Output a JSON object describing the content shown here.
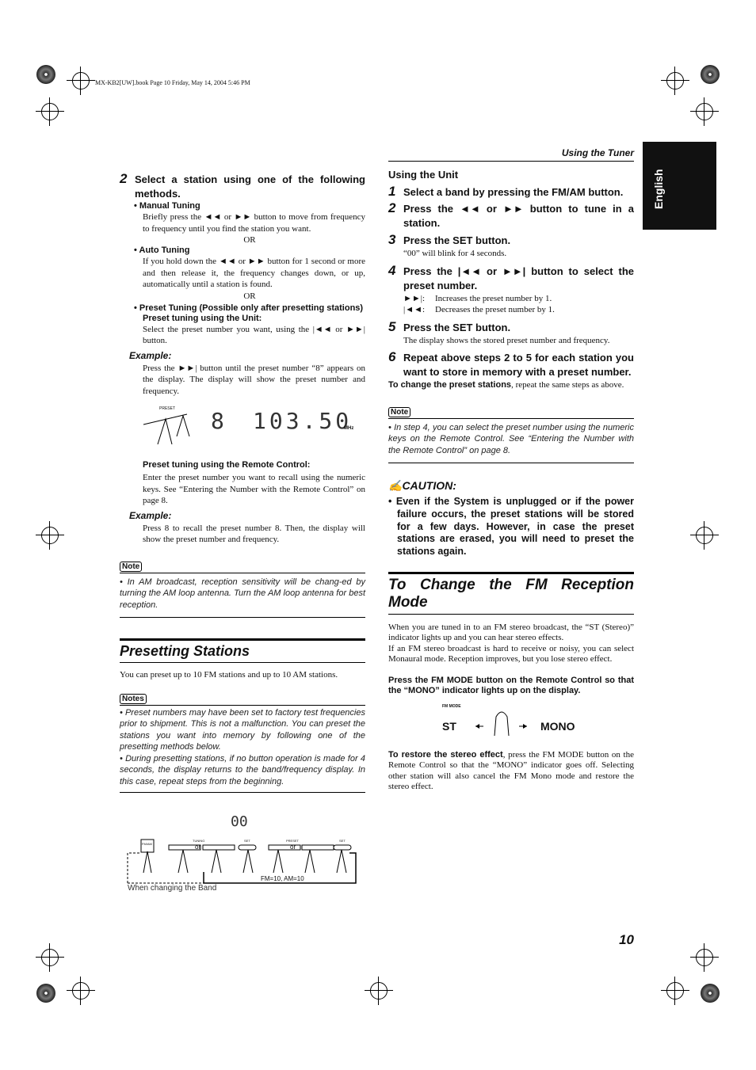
{
  "header": {
    "file_info": "MX-KB2[UW].book  Page 10  Friday, May 14, 2004  5:46 PM",
    "section": "Using the Tuner",
    "language_tab": "English",
    "page_number": "10"
  },
  "left": {
    "step2": {
      "num": "2",
      "title": "Select a station using one of the following methods.",
      "manual_title": "• Manual Tuning",
      "manual_text": "Briefly press the ◄◄ or ►► button to move from frequency to frequency until you find the station you want.",
      "or1": "OR",
      "auto_title": "• Auto Tuning",
      "auto_text": "If you hold down the ◄◄ or ►► button for 1 second or more and then release it, the frequency changes down, or up, automatically until a station is found.",
      "or2": "OR",
      "preset_title": "• Preset Tuning (Possible only after presetting stations)",
      "preset_unit_title": "Preset tuning using the Unit:",
      "preset_unit_text": "Select the preset number you want, using the |◄◄ or ►►| button.",
      "example1_label": "Example:",
      "example1_text": "Press the ►►| button until the preset number “8” appears on the display. The display will show the preset number and frequency.",
      "display": {
        "preset": "8",
        "freq": "103.50",
        "unit": "MHz",
        "button_label": "PRESET"
      },
      "remote_title": "Preset tuning using the Remote Control:",
      "remote_text": "Enter the preset number you want to recall using the numeric keys. See “Entering the Number with the Remote Control” on page 8.",
      "example2_label": "Example:",
      "example2_text": "Press 8 to recall the preset number 8. Then, the display will show the preset number and frequency."
    },
    "note1": {
      "tag": "Note",
      "text": "• In AM broadcast, reception sensitivity will be chang-ed by turning the AM loop antenna. Turn the AM loop antenna for best reception."
    },
    "presetting": {
      "title": "Presetting Stations",
      "intro": "You can preset up to 10 FM stations and up to 10 AM stations.",
      "notes_tag": "Notes",
      "notes": [
        "• Preset numbers may have been set to factory test frequencies prior to shipment. This is not a malfunction. You can preset the stations you want into memory by following one of the presetting methods below.",
        "• During presetting stations, if no button operation is made for 4 seconds, the display returns to the band/frequency display. In this case, repeat steps from the beginning."
      ]
    },
    "diagram": {
      "blink": "00",
      "fmam": "FM/AM",
      "tuning": "TUNING",
      "preset": "PRESET",
      "set": "SET",
      "or": "or",
      "count": "FM=10, AM=10",
      "band_note": "When changing the Band"
    }
  },
  "right": {
    "unit_title": "Using the Unit",
    "steps": [
      {
        "num": "1",
        "title": "Select a band by pressing the FM/AM button."
      },
      {
        "num": "2",
        "title": "Press the ◄◄ or ►► button to tune in a station."
      },
      {
        "num": "3",
        "title": "Press the SET button.",
        "text": "“00” will blink for 4 seconds."
      },
      {
        "num": "4",
        "title": "Press the |◄◄ or ►►| button to select the preset number.",
        "items": [
          {
            "key": "►►|:",
            "val": "Increases the preset number by 1."
          },
          {
            "key": "|◄◄:",
            "val": "Decreases the preset number by 1."
          }
        ]
      },
      {
        "num": "5",
        "title": "Press the SET button.",
        "text": "The display shows the stored preset number and frequency."
      },
      {
        "num": "6",
        "title": "Repeat above steps 2 to 5 for each station you want to store in memory with a preset number."
      }
    ],
    "change_bold": "To change the preset stations",
    "change_rest": ", repeat the same steps as above.",
    "note": {
      "tag": "Note",
      "text": "• In step 4, you can select the preset number using the numeric keys on the Remote Control. See “Entering the Number with the Remote Control” on page 8."
    },
    "caution": {
      "title": "CAUTION:",
      "text": "• Even if the System is unplugged or if the power failure occurs, the preset stations will be stored for a few days. However, in case the preset stations are erased, you will need to preset the stations again."
    },
    "fm": {
      "title": "To Change the FM Reception Mode",
      "p1": "When you are tuned in to an FM stereo broadcast, the “ST (Stereo)” indicator lights up and you can hear stereo effects.",
      "p2": "If an FM stereo broadcast is hard to receive or noisy, you can select Monaural mode. Reception improves, but you lose stereo effect.",
      "instruction": "Press the FM MODE button on the Remote Control so that the “MONO” indicator lights up on the display.",
      "st": "ST",
      "mono": "MONO",
      "btn": "FM MODE",
      "restore_bold": "To restore the stereo effect",
      "restore_rest": ", press the FM MODE button on the Remote Control so that the “MONO” indicator goes off. Selecting other station will also cancel the FM Mono mode and restore the stereo effect."
    }
  }
}
